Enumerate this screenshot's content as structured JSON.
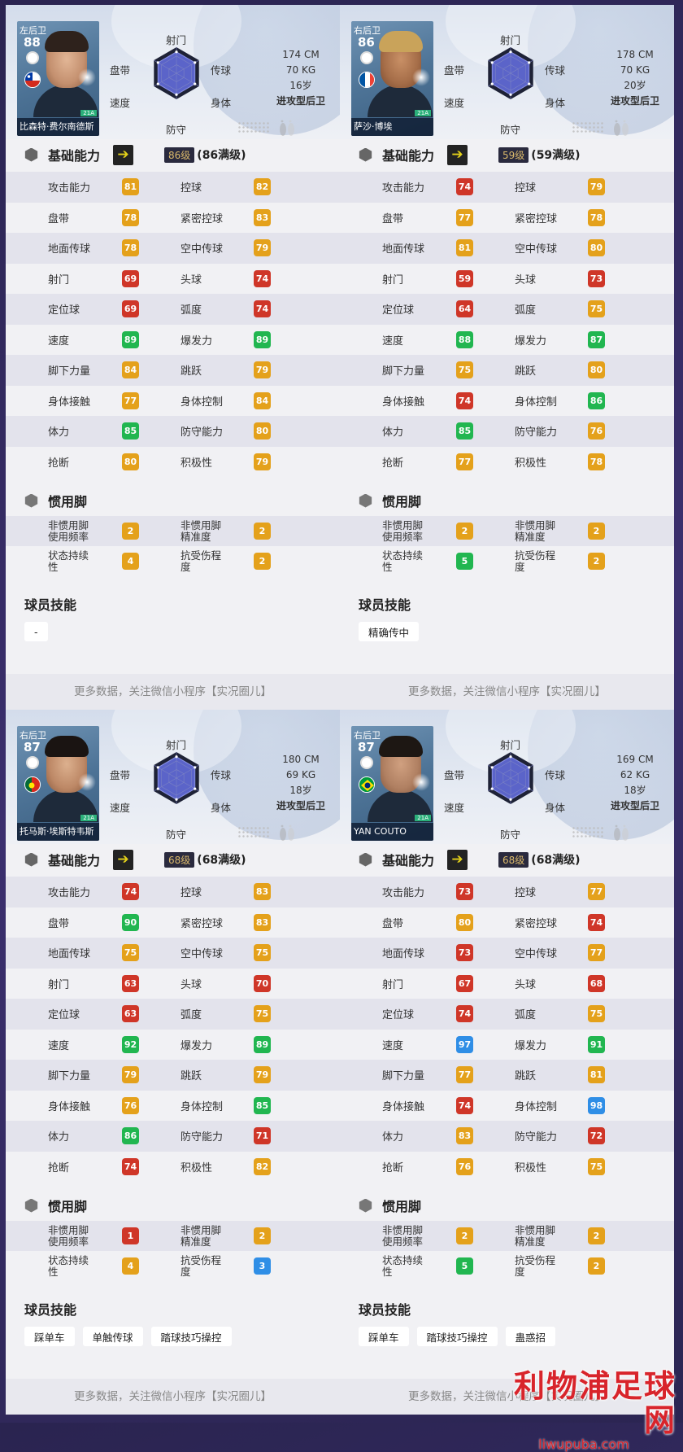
{
  "colors": {
    "red": "#cf3628",
    "orange": "#e4a11b",
    "green": "#21b650",
    "blue": "#2f8ee6"
  },
  "labels": {
    "radar": {
      "shoot": "射门",
      "dribble": "盘带",
      "pass": "传球",
      "speed": "速度",
      "physical": "身体",
      "defense": "防守"
    },
    "section_base": "基础能力",
    "section_foot": "惯用脚",
    "section_skills": "球员技能",
    "footer": "更多数据，关注微信小程序【实况圈儿】",
    "stat_names": [
      "攻击能力",
      "控球",
      "盘带",
      "紧密控球",
      "地面传球",
      "空中传球",
      "射门",
      "头球",
      "定位球",
      "弧度",
      "速度",
      "爆发力",
      "脚下力量",
      "跳跃",
      "身体接触",
      "身体控制",
      "体力",
      "防守能力",
      "抢断",
      "积极性"
    ],
    "foot_names": [
      "非惯用脚\n使用频率",
      "非惯用脚\n精准度",
      "状态持续\n性",
      "抗受伤程\n度"
    ]
  },
  "watermark": {
    "title": "利物浦足球网",
    "url": "liwupuba.com"
  },
  "players": [
    {
      "position": "左后卫",
      "overall": "88",
      "name": "比森特·费尔南德斯",
      "tag": "21A",
      "flag": "chile",
      "height": "174 CM",
      "weight": "70 KG",
      "age": "16岁",
      "type": "进攻型后卫",
      "level": "86级",
      "level_max": "(86满级)",
      "stats": [
        81,
        82,
        78,
        83,
        78,
        79,
        69,
        74,
        69,
        74,
        89,
        89,
        84,
        79,
        77,
        84,
        85,
        80,
        80,
        79
      ],
      "foot": [
        2,
        2,
        4,
        2
      ],
      "skills": [
        "-"
      ]
    },
    {
      "position": "右后卫",
      "overall": "86",
      "name": "萨沙·博埃",
      "tag": "21A",
      "flag": "france",
      "height": "178 CM",
      "weight": "70 KG",
      "age": "20岁",
      "type": "进攻型后卫",
      "level": "59级",
      "level_max": "(59满级)",
      "stats": [
        74,
        79,
        77,
        78,
        81,
        80,
        59,
        73,
        64,
        75,
        88,
        87,
        75,
        80,
        74,
        86,
        85,
        76,
        77,
        78
      ],
      "foot": [
        2,
        2,
        5,
        2
      ],
      "skills": [
        "精确传中"
      ]
    },
    {
      "position": "右后卫",
      "overall": "87",
      "name": "托马斯·埃斯特韦斯",
      "tag": "21A",
      "flag": "portugal",
      "height": "180 CM",
      "weight": "69 KG",
      "age": "18岁",
      "type": "进攻型后卫",
      "level": "68级",
      "level_max": "(68满级)",
      "stats": [
        74,
        83,
        90,
        83,
        75,
        75,
        63,
        70,
        63,
        75,
        92,
        89,
        79,
        79,
        76,
        85,
        86,
        71,
        74,
        82
      ],
      "foot": [
        1,
        2,
        4,
        3
      ],
      "skills": [
        "踩单车",
        "单触传球",
        "踏球技巧操控"
      ]
    },
    {
      "position": "右后卫",
      "overall": "87",
      "name": "YAN COUTO",
      "tag": "21A",
      "flag": "brazil",
      "height": "169 CM",
      "weight": "62 KG",
      "age": "18岁",
      "type": "进攻型后卫",
      "level": "68级",
      "level_max": "(68满级)",
      "stats": [
        73,
        77,
        80,
        74,
        73,
        77,
        67,
        68,
        74,
        75,
        97,
        91,
        77,
        81,
        74,
        98,
        83,
        72,
        76,
        75
      ],
      "foot": [
        2,
        2,
        5,
        2
      ],
      "skills": [
        "踩单车",
        "踏球技巧操控",
        "蛊惑招"
      ]
    }
  ]
}
